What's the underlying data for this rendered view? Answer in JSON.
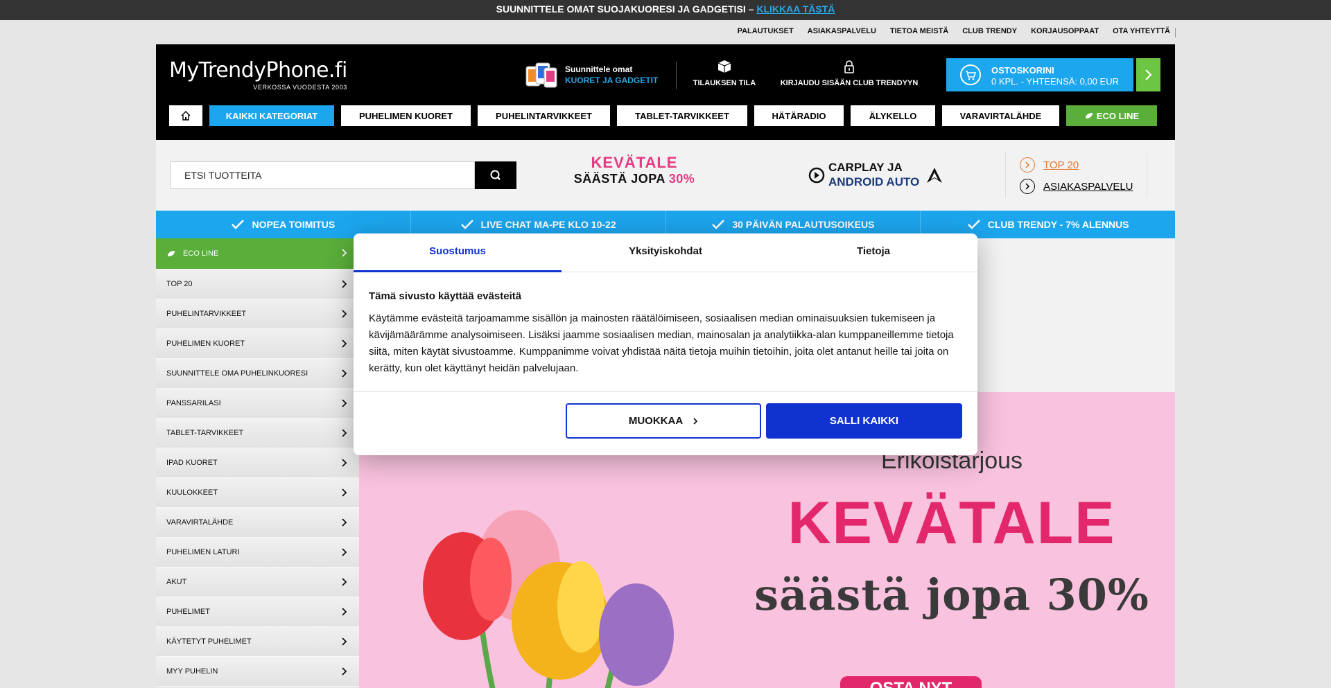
{
  "announcement": {
    "text": "SUUNNITTELE OMAT SUOJAKUORESI JA GADGETISI –",
    "link": "KLIKKAA TÄSTÄ"
  },
  "utility_links": [
    "PALAUTUKSET",
    "ASIAKASPALVELU",
    "TIETOA MEISTÄ",
    "CLUB TRENDY",
    "KORJAUSOPPAAT",
    "OTA YHTEYTTÄ"
  ],
  "header": {
    "logo_name": "MyTrendyPhone.fi",
    "logo_tagline": "VERKOSSA VUODESTA 2003",
    "design_line1": "Suunnittele omat",
    "design_line2": "KUORET JA GADGETIT",
    "order_status": "TILAUKSEN TILA",
    "login": "KIRJAUDU SISÄÄN CLUB TRENDYYN",
    "cart_title": "OSTOSKORINI",
    "cart_summary": "0 KPL. - YHTEENSÄ: 0,00 EUR"
  },
  "nav": {
    "all_categories": "KAIKKI KATEGORIAT",
    "items": [
      "PUHELIMEN KUORET",
      "PUHELINTARVIKKEET",
      "TABLET-TARVIKKEET",
      "HÄTÄRADIO",
      "ÄLYKELLO",
      "VARAVIRTALÄHDE"
    ],
    "eco": "ECO LINE"
  },
  "search": {
    "placeholder": "ETSI TUOTTEITA"
  },
  "promos": {
    "sale_line1": "KEVÄTALE",
    "sale_line2": "SÄÄSTÄ JOPA",
    "sale_pct": "30%",
    "carplay_line1": "CARPLAY JA",
    "carplay_line2": "ANDROID AUTO"
  },
  "quick_links": [
    "TOP 20",
    "ASIAKASPALVELU"
  ],
  "benefits": [
    "NOPEA TOIMITUS",
    "LIVE CHAT MA-PE KLO 10-22",
    "30 PÄIVÄN PALAUTUSOIKEUS",
    "CLUB TRENDY - 7% ALENNUS"
  ],
  "sidebar": {
    "eco": "ECO LINE",
    "items": [
      "TOP 20",
      "PUHELINTARVIKKEET",
      "PUHELIMEN KUORET",
      "SUUNNITTELE OMA PUHELINKUORESI",
      "PANSSARILASI",
      "TABLET-TARVIKKEET",
      "IPAD KUORET",
      "KUULOKKEET",
      "VARAVIRTALÄHDE",
      "PUHELIMEN LATURI",
      "AKUT",
      "PUHELIMET",
      "KÄYTETYT PUHELIMET",
      "MYY PUHELIN"
    ]
  },
  "hero": {
    "subtitle": "Erikoistarjous",
    "title": "KEVÄTALE",
    "save": "säästä jopa 30%",
    "cta": "OSTA NYT"
  },
  "cookie_dialog": {
    "tabs": [
      "Suostumus",
      "Yksityiskohdat",
      "Tietoja"
    ],
    "title": "Tämä sivusto käyttää evästeitä",
    "body": "Käytämme evästeitä tarjoamamme sisällön ja mainosten räätälöimiseen, sosiaalisen median ominaisuuksien tukemiseen ja kävijämäärämme analysoimiseen. Lisäksi jaamme sosiaalisen median, mainosalan ja analytiikka-alan kumppaneillemme tietoja siitä, miten käytät sivustoamme. Kumppanimme voivat yhdistää näitä tietoja muihin tietoihin, joita olet antanut heille tai joita on kerätty, kun olet käyttänyt heidän palvelujaan.",
    "edit_button": "MUOKKAA",
    "allow_button": "SALLI KAIKKI"
  },
  "colors": {
    "accent_blue": "#1ca6ee",
    "eco_green": "#5aae3a",
    "dialog_blue": "#1032cf",
    "sale_pink": "#e3276b"
  }
}
